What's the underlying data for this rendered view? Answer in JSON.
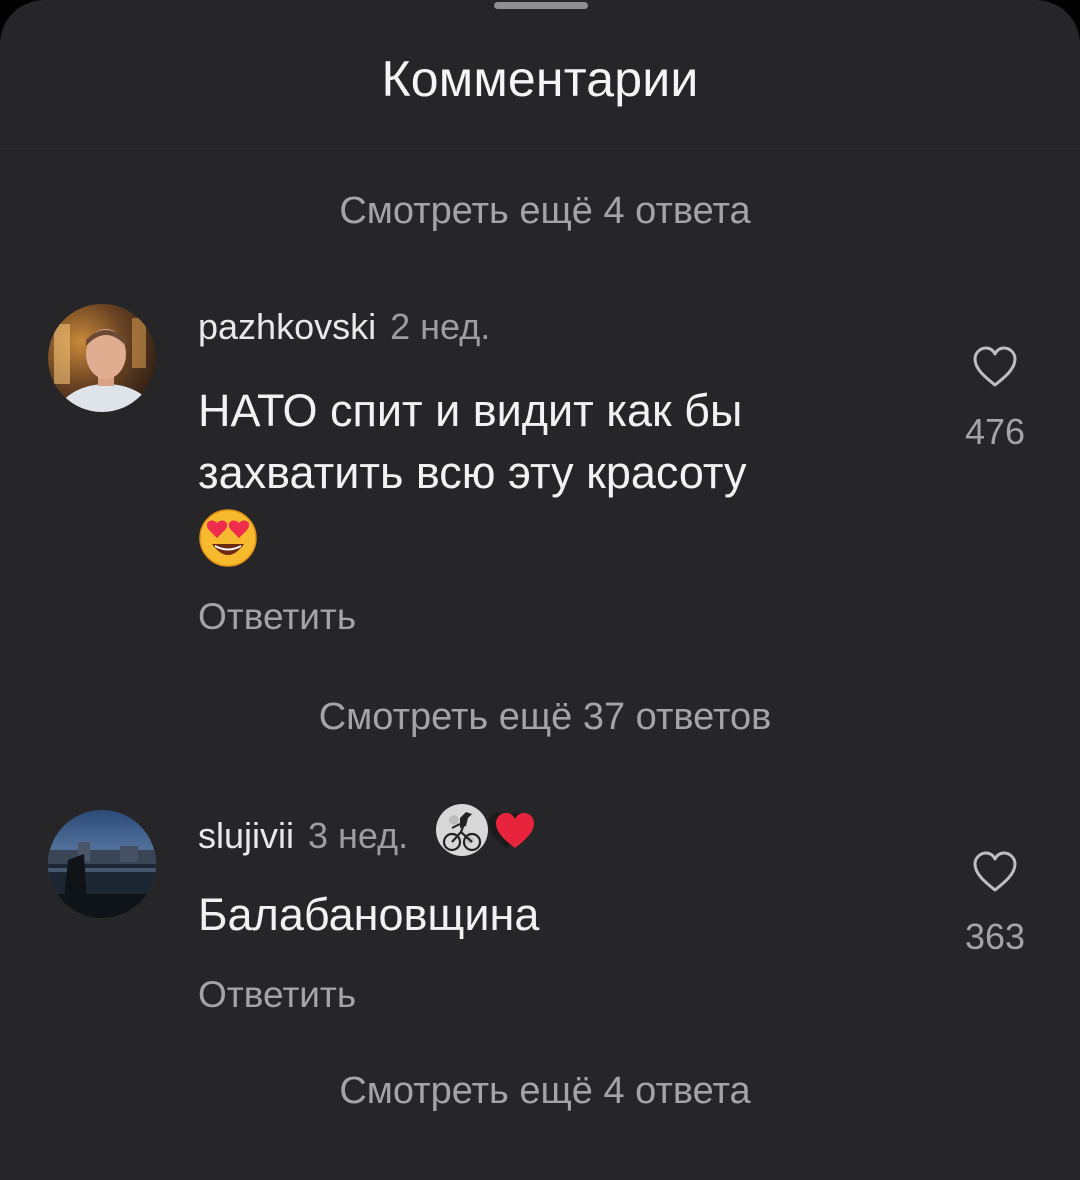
{
  "sheet": {
    "title": "Комментарии"
  },
  "view_more": [
    "Смотреть ещё 4 ответа",
    "Смотреть ещё 37 ответов",
    "Смотреть ещё 4 ответа"
  ],
  "comments": [
    {
      "username": "pazhkovski",
      "time": "2 нед.",
      "text_lines": [
        "НАТО спит и видит как бы",
        "захватить всю эту красоту"
      ],
      "emoji": "heart-eyes-emoji",
      "reply_label": "Ответить",
      "likes": "476"
    },
    {
      "username": "slujivii",
      "time": "3 нед.",
      "badges": [
        "moon-dinosaur-bike-icon",
        "heart-icon"
      ],
      "text": "Балабановщина",
      "reply_label": "Ответить",
      "likes": "363"
    }
  ],
  "colors": {
    "background": "#262629",
    "text_primary": "#f2f2f4",
    "text_secondary": "#a3a3a8",
    "heart_badge": "#e8243c"
  }
}
